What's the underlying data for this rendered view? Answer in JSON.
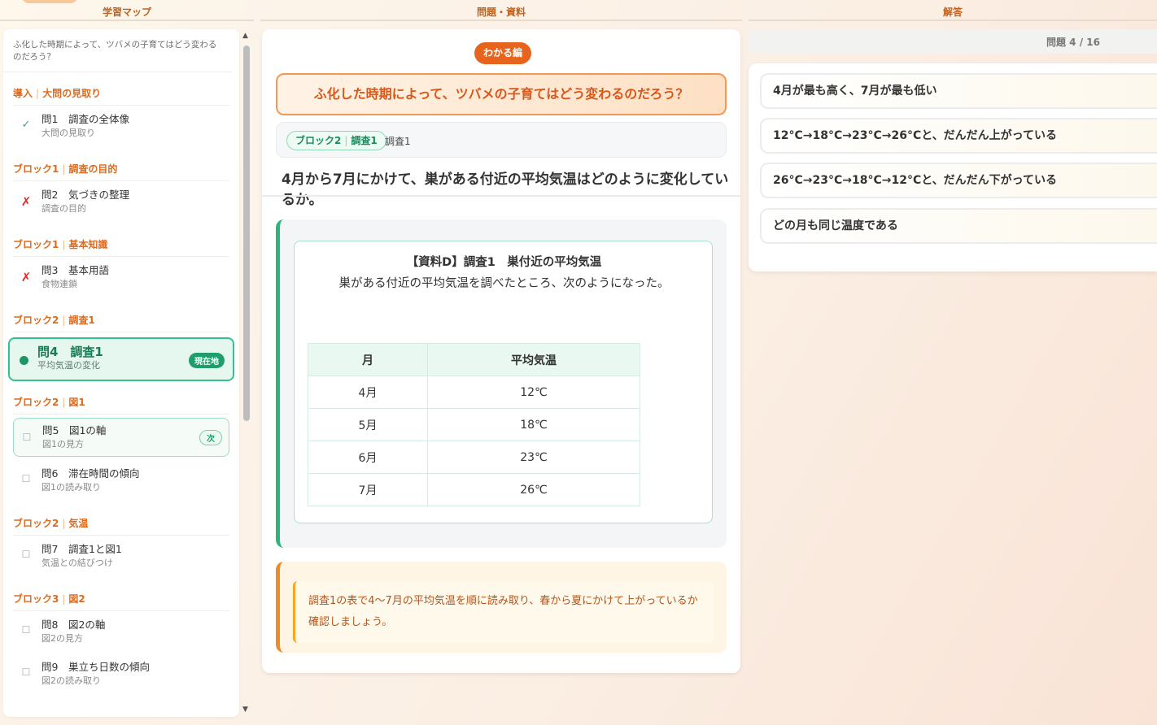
{
  "columns": {
    "map": "学習マップ",
    "problem": "問題・資料",
    "answer": "解答"
  },
  "sidebar": {
    "title": "ふ化した時期によって、ツバメの子育てはどう変わるのだろう？",
    "sections": [
      {
        "block": "導入",
        "topic": "大問の見取り",
        "items": [
          {
            "title": "問1　調査の全体像",
            "sub": "大問の見取り",
            "status": "check"
          }
        ]
      },
      {
        "block": "ブロック1",
        "topic": "調査の目的",
        "items": [
          {
            "title": "問2　気づきの整理",
            "sub": "調査の目的",
            "status": "cross"
          }
        ]
      },
      {
        "block": "ブロック1",
        "topic": "基本知識",
        "items": [
          {
            "title": "問3　基本用語",
            "sub": "食物連鎖",
            "status": "cross"
          }
        ]
      },
      {
        "block": "ブロック2",
        "topic": "調査1",
        "items": [
          {
            "title": "問4　調査1",
            "sub": "平均気温の変化",
            "status": "current",
            "badge": "現在地"
          }
        ]
      },
      {
        "block": "ブロック2",
        "topic": "図1",
        "items": [
          {
            "title": "問5　図1の軸",
            "sub": "図1の見方",
            "status": "next",
            "badge": "次"
          },
          {
            "title": "問6　滞在時間の傾向",
            "sub": "図1の読み取り",
            "status": "box"
          }
        ]
      },
      {
        "block": "ブロック2",
        "topic": "気温",
        "items": [
          {
            "title": "問7　調査1と図1",
            "sub": "気温との結びつけ",
            "status": "box"
          }
        ]
      },
      {
        "block": "ブロック3",
        "topic": "図2",
        "items": [
          {
            "title": "問8　図2の軸",
            "sub": "図2の見方",
            "status": "box"
          },
          {
            "title": "問9　巣立ち日数の傾向",
            "sub": "図2の読み取り",
            "status": "box"
          }
        ]
      }
    ],
    "marks": {
      "check": "✓",
      "cross": "✗",
      "box": "☐",
      "next": "☐",
      "current": ""
    }
  },
  "problem": {
    "level_badge": "わかる編",
    "main_question": "ふ化した時期によって、ツバメの子育てはどう変わるのだろう？",
    "breadcrumb": {
      "block": "ブロック2",
      "topic": "調査1",
      "current": "調査1"
    },
    "question": "4月から7月にかけて、巣がある付近の平均気温はどのように変化しているか。",
    "resource": {
      "title": "【資料D】調査1　巣付近の平均気温",
      "description": "巣がある付近の平均気温を調べたところ、次のようになった。",
      "table": {
        "headers": [
          "月",
          "平均気温"
        ],
        "rows": [
          [
            "4月",
            "12℃"
          ],
          [
            "5月",
            "18℃"
          ],
          [
            "6月",
            "23℃"
          ],
          [
            "7月",
            "26℃"
          ]
        ]
      }
    },
    "hint": "調査1の表で4〜7月の平均気温を順に読み取り、春から夏にかけて上がっているか確認しましょう。"
  },
  "answer": {
    "page_indicator": "問題 4 / 16",
    "choices": [
      "4月が最も高く、7月が最も低い",
      "12°C→18°C→23°C→26°Cと、だんだん上がっている",
      "26°C→23°C→18°C→12°Cと、だんだん下がっている",
      "どの月も同じ温度である"
    ]
  }
}
